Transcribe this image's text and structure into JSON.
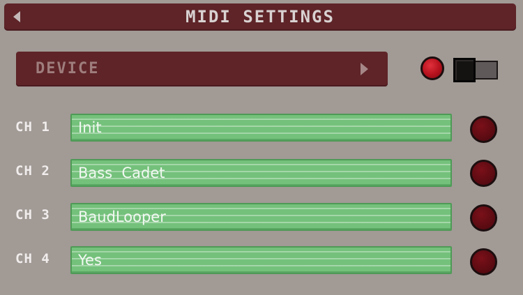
{
  "header": {
    "title": "MIDI SETTINGS",
    "back_icon": "back-arrow-icon"
  },
  "device": {
    "label": "DEVICE",
    "arrow_icon": "chevron-right-icon"
  },
  "status": {
    "led_color": "#c21622",
    "toggle_on": false
  },
  "channels": [
    {
      "label": "CH 1",
      "value": "Init",
      "active": false
    },
    {
      "label": "CH 2",
      "value": "Bass  Cadet",
      "active": false
    },
    {
      "label": "CH 3",
      "value": "BaudLooper",
      "active": false
    },
    {
      "label": "CH 4",
      "value": "Yes",
      "active": false
    }
  ],
  "colors": {
    "background": "#a19a95",
    "bar": "#5e2428",
    "field": "#74c17b",
    "field_border": "#4e9a56",
    "channel_led_off": "#5d0b12"
  }
}
